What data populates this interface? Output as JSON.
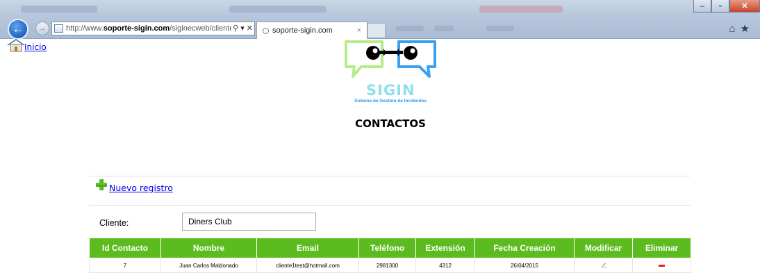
{
  "browser": {
    "address_prefix": "http://www.",
    "address_domain": "soporte-sigin.com",
    "address_path": "/siginecweb/cliente/ed",
    "address_tools": "⚲ ▾ ✕",
    "tab_title": "soporte-sigin.com",
    "tab_close": "×"
  },
  "nav": {
    "home_label": "Inicio"
  },
  "logo": {
    "word": "SIGIN",
    "subtitle": "Sistema de Gestion de Incidentes"
  },
  "page": {
    "title": "CONTACTOS"
  },
  "actions": {
    "new_record": "Nuevo registro"
  },
  "filter": {
    "client_label": "Cliente:",
    "client_value": "Diners Club"
  },
  "table": {
    "headers": {
      "id": "Id Contacto",
      "name": "Nombre",
      "email": "Email",
      "phone": "Teléfono",
      "ext": "Extensión",
      "created": "Fecha Creación",
      "edit": "Modificar",
      "delete": "Eliminar"
    },
    "rows": [
      {
        "id": "7",
        "name": "Juan Carlos Maldonado",
        "email": "cliente1test@hotmail.com",
        "phone": "2981300",
        "ext": "4312",
        "created": "26/04/2015"
      }
    ]
  },
  "colors": {
    "header_green": "#5cbc1f",
    "link_blue": "#0000ee",
    "delete_red": "#e2231a",
    "logo_green": "#b5ec8a",
    "logo_blue": "#3aa0f2"
  },
  "icons": [
    "back-arrow-icon",
    "forward-arrow-icon",
    "home-icon",
    "plus-icon",
    "edit-pencil-icon",
    "delete-minus-icon"
  ]
}
